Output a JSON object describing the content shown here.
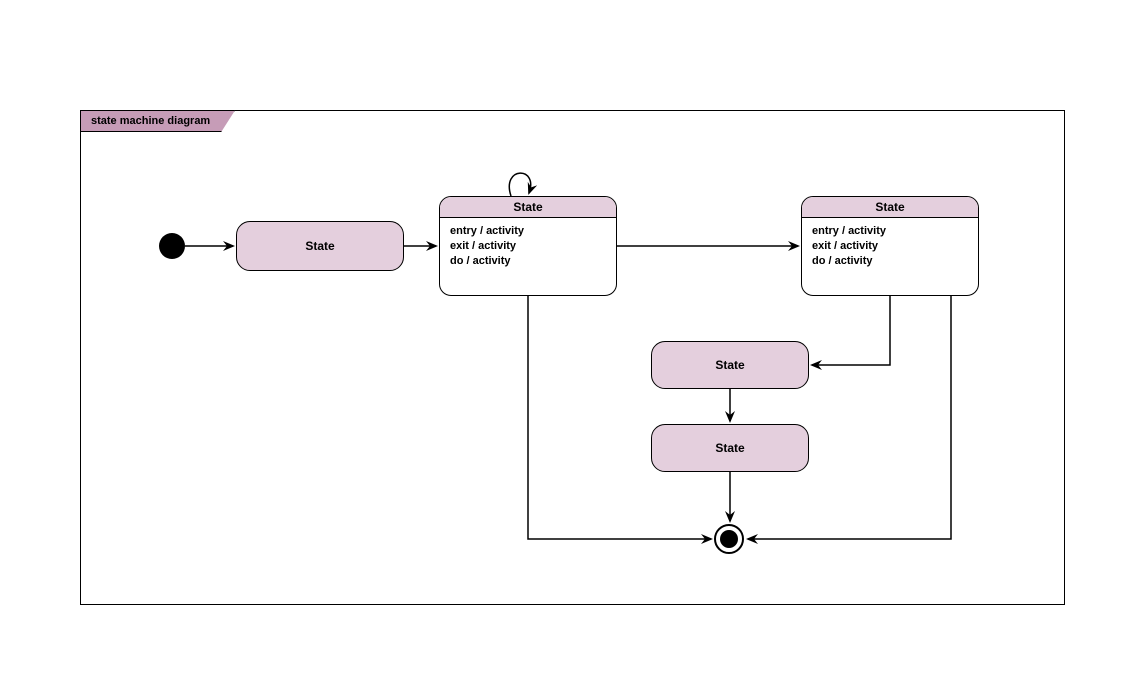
{
  "diagram": {
    "title": "state machine diagram",
    "states": {
      "simple1": {
        "label": "State"
      },
      "simple2": {
        "label": "State"
      },
      "simple3": {
        "label": "State"
      },
      "composite1": {
        "label": "State",
        "lines": [
          "entry / activity",
          "exit / activity",
          "do / activity"
        ]
      },
      "composite2": {
        "label": "State",
        "lines": [
          "entry / activity",
          "exit / activity",
          "do / activity"
        ]
      }
    }
  }
}
